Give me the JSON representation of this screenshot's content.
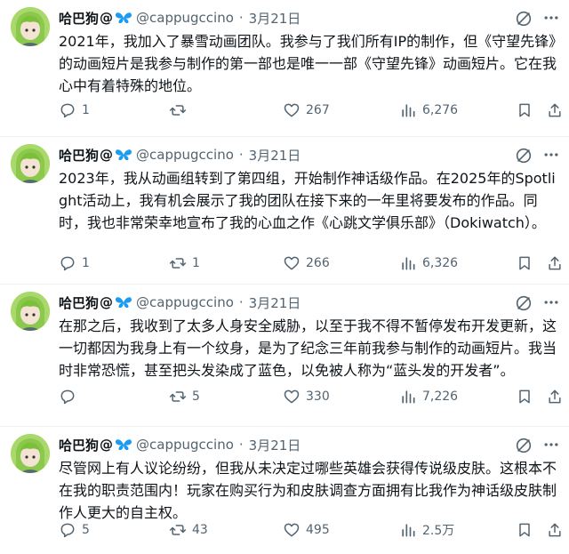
{
  "author": {
    "name": "哈巴狗",
    "at_symbol": "@",
    "handle": "@cappugccino",
    "avatar_icon": "anime-avatar-icon"
  },
  "colors": {
    "text": "#0f1419",
    "muted": "#536471",
    "butterfly": "#1d9bf0",
    "avatar_bg": "#a8d96a"
  },
  "tweets": [
    {
      "date": "3月21日",
      "text": "2021年，我加入了暴雪动画团队。我参与了我们所有IP的制作，但《守望先锋》的动画短片是我参与制作的第一部也是唯一一部《守望先锋》动画短片。它在我心中有着特殊的地位。",
      "replies": "1",
      "retweets": "",
      "likes": "267",
      "views": "6,276"
    },
    {
      "date": "3月21日",
      "text": "2023年，我从动画组转到了第四组，开始制作神话级作品。在2025年的Spotlight活动上，我有机会展示了我的团队在接下来的一年里将要发布的作品。同时，我也非常荣幸地宣布了我的心血之作《心跳文学俱乐部》（Dokiwatch）。",
      "replies": "1",
      "retweets": "1",
      "likes": "266",
      "views": "6,326"
    },
    {
      "date": "3月21日",
      "text": "在那之后，我收到了太多人身安全威胁，以至于我不得不暂停发布开发更新，这一切都因为我身上有一个纹身，是为了纪念三年前我参与制作的动画短片。我当时非常恐慌，甚至把头发染成了蓝色，以免被人称为“蓝头发的开发者”。",
      "replies": "",
      "retweets": "5",
      "likes": "330",
      "views": "7,226"
    },
    {
      "date": "3月21日",
      "text": "尽管网上有人议论纷纷，但我从未决定过哪些英雄会获得传说级皮肤。这根本不在我的职责范围内！玩家在购买行为和皮肤调查方面拥有比我作为神话级皮肤制作人更大的自主权。",
      "replies": "5",
      "retweets": "43",
      "likes": "495",
      "views": "2.5万"
    }
  ]
}
